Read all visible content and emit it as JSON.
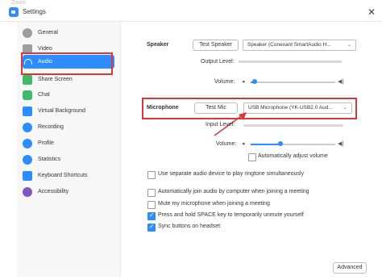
{
  "background_window_title": "Zoom",
  "window": {
    "title": "Settings",
    "close_label": "✕"
  },
  "sidebar": {
    "items": [
      {
        "label": "General",
        "icon": "gear-icon",
        "color": "#9e9e9e",
        "active": false
      },
      {
        "label": "Video",
        "icon": "video-camera-icon",
        "color": "#9e9e9e",
        "active": false
      },
      {
        "label": "Audio",
        "icon": "headphones-icon",
        "color": "#2d8cff",
        "active": true
      },
      {
        "label": "Share Screen",
        "icon": "share-screen-icon",
        "color": "#3dbb6a",
        "active": false
      },
      {
        "label": "Chat",
        "icon": "chat-icon",
        "color": "#3dbb6a",
        "active": false
      },
      {
        "label": "Virtual Background",
        "icon": "person-background-icon",
        "color": "#2d8cff",
        "active": false
      },
      {
        "label": "Recording",
        "icon": "record-icon",
        "color": "#2d8cff",
        "active": false
      },
      {
        "label": "Profile",
        "icon": "profile-icon",
        "color": "#2d8cff",
        "active": false
      },
      {
        "label": "Statistics",
        "icon": "statistics-icon",
        "color": "#2d8cff",
        "active": false
      },
      {
        "label": "Keyboard Shortcuts",
        "icon": "keyboard-icon",
        "color": "#2d8cff",
        "active": false
      },
      {
        "label": "Accessibility",
        "icon": "accessibility-icon",
        "color": "#7e57c2",
        "active": false
      }
    ]
  },
  "speaker": {
    "label": "Speaker",
    "test_button": "Test Speaker",
    "device": "Speaker (Conexant SmartAudio H...",
    "output_level_label": "Output Level:",
    "volume_label": "Volume:",
    "volume_percent": 5
  },
  "microphone": {
    "label": "Microphone",
    "test_button": "Test Mic",
    "device": "USB Microphone (YK-USB2.0 Aud...",
    "input_level_label": "Input Level:",
    "volume_label": "Volume:",
    "volume_percent": 35,
    "auto_adjust_label": "Automatically adjust volume",
    "auto_adjust_checked": false
  },
  "options": [
    {
      "label": "Use separate audio device to play ringtone simultaneously",
      "checked": false
    },
    {
      "label": "Automatically join audio by computer when joining a meeting",
      "checked": false
    },
    {
      "label": "Mute my microphone when joining a meeting",
      "checked": false
    },
    {
      "label": "Press and hold SPACE key to temporarily unmute yourself",
      "checked": true
    },
    {
      "label": "Sync buttons on headset",
      "checked": true
    }
  ],
  "advanced_button": "Advanced",
  "colors": {
    "accent": "#2d8cff",
    "highlight": "#d9383a"
  },
  "chevron": "⌄"
}
